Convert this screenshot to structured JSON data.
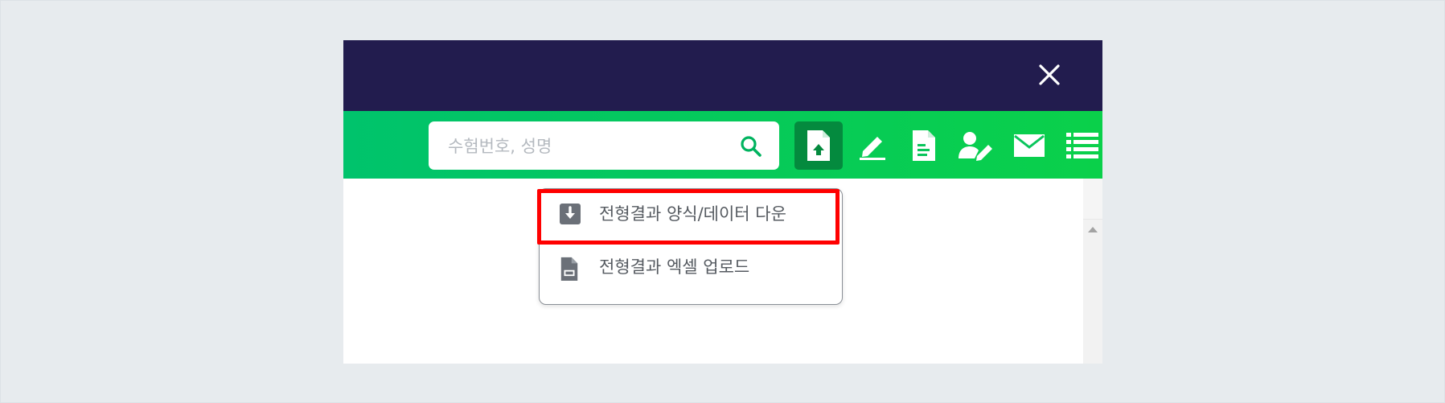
{
  "search": {
    "placeholder": "수험번호, 성명"
  },
  "toolbar": {
    "tools": [
      {
        "icon": "file-upload-icon",
        "active": true
      },
      {
        "icon": "pencil-icon"
      },
      {
        "icon": "document-icon"
      },
      {
        "icon": "user-edit-icon"
      },
      {
        "icon": "mail-icon"
      },
      {
        "icon": "list-icon"
      }
    ]
  },
  "dropdown": {
    "items": [
      {
        "icon": "download-icon",
        "label": "전형결과 양식/데이터 다운"
      },
      {
        "icon": "file-icon",
        "label": "전형결과 엑셀 업로드"
      }
    ]
  },
  "colors": {
    "header_bg": "#221c4e",
    "toolbar_bg": "#00c36c",
    "active_tool_bg": "#048a3e",
    "highlight_border": "#ff0000",
    "page_bg": "#e7ebee"
  }
}
